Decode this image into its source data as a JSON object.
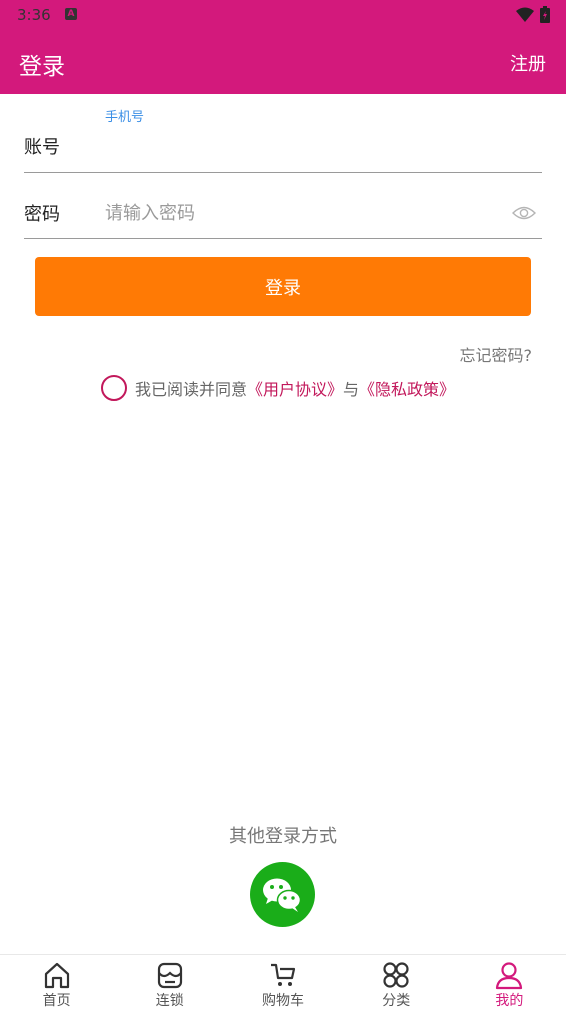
{
  "status": {
    "time": "3:36",
    "notification_glyph": "A"
  },
  "header": {
    "title": "登录",
    "register_label": "注册"
  },
  "form": {
    "account_label": "账号",
    "account_hint": "手机号",
    "account_value": "",
    "password_label": "密码",
    "password_placeholder": "请输入密码",
    "login_label": "登录",
    "forgot_label": "忘记密码?"
  },
  "agreement": {
    "prefix": "我已阅读并同意",
    "user_agreement": "《用户协议》",
    "conjunction": "与",
    "privacy_policy": "《隐私政策》",
    "checked": false
  },
  "other_login": {
    "title": "其他登录方式",
    "wechat_icon": "wechat-icon"
  },
  "tabs": [
    {
      "label": "首页",
      "icon": "home-icon"
    },
    {
      "label": "连锁",
      "icon": "store-icon"
    },
    {
      "label": "购物车",
      "icon": "cart-icon"
    },
    {
      "label": "分类",
      "icon": "category-icon"
    },
    {
      "label": "我的",
      "icon": "profile-icon",
      "active": true
    }
  ],
  "colors": {
    "brand": "#d3197c",
    "button": "#ff7a05",
    "link": "#c2185b",
    "hint": "#3b8fe6",
    "wechat": "#1aad19"
  }
}
